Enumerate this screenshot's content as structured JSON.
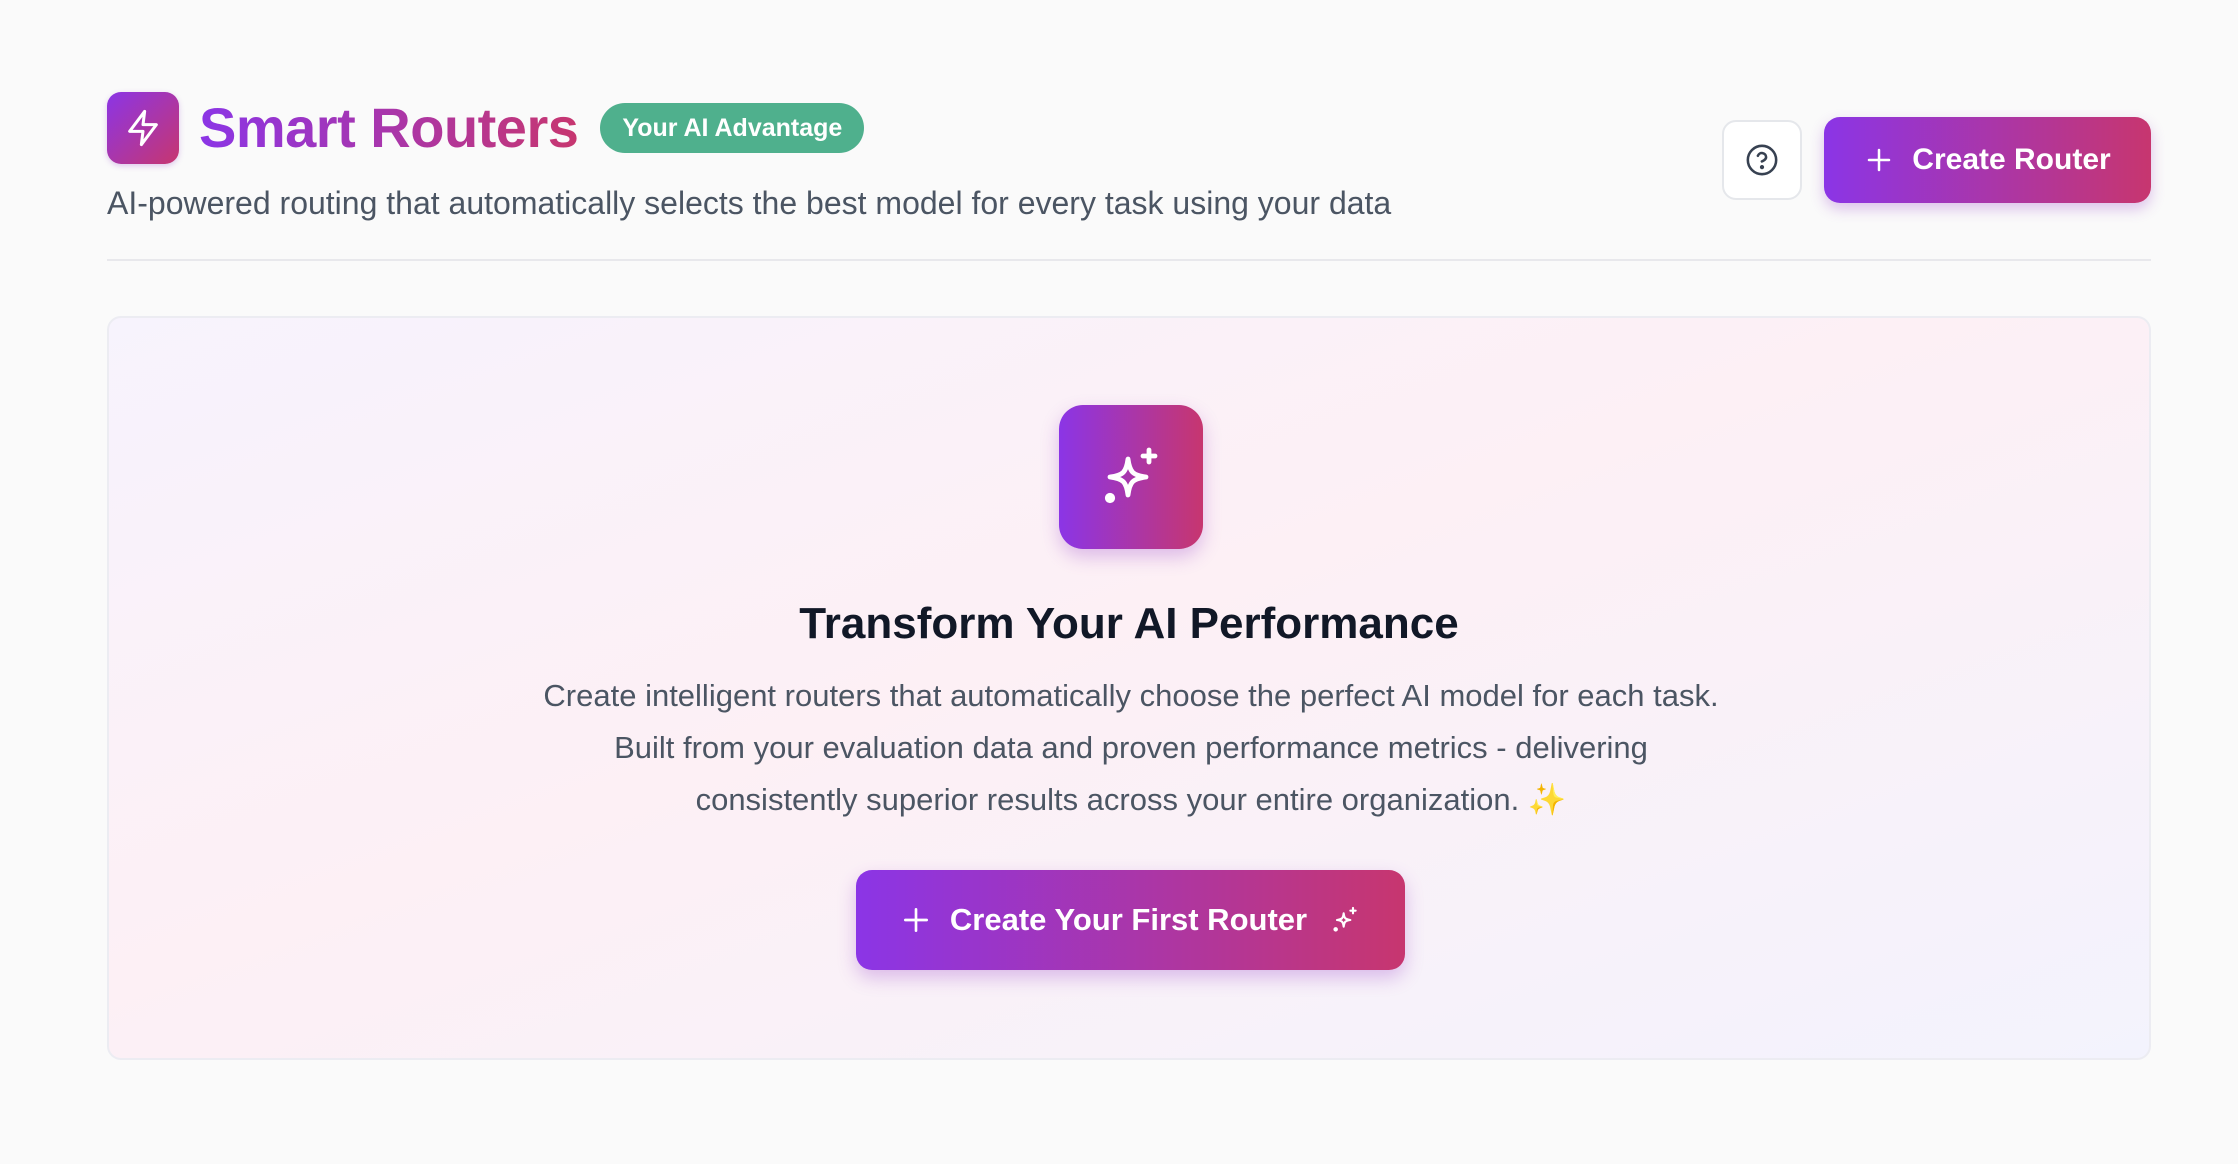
{
  "header": {
    "logo_icon": "lightning-bolt-icon",
    "title": "Smart Routers",
    "badge": "Your AI Advantage",
    "subtitle": "AI-powered routing that automatically selects the best model for every task using your data",
    "help_icon": "question-circle-icon",
    "create_button_label": "Create Router",
    "create_button_icon": "plus-icon"
  },
  "hero": {
    "icon": "sparkles-icon",
    "title": "Transform Your AI Performance",
    "description": "Create intelligent routers that automatically choose the perfect AI model for each task. Built from your evaluation data and proven performance metrics - delivering consistently superior results across your entire organization. ✨",
    "cta_label": "Create Your First Router",
    "cta_left_icon": "plus-icon",
    "cta_right_icon": "sparkles-icon"
  },
  "colors": {
    "gradient_start": "#8b35e6",
    "gradient_end": "#c7366f",
    "badge_green": "#4fb08d",
    "background": "#fafafa"
  }
}
